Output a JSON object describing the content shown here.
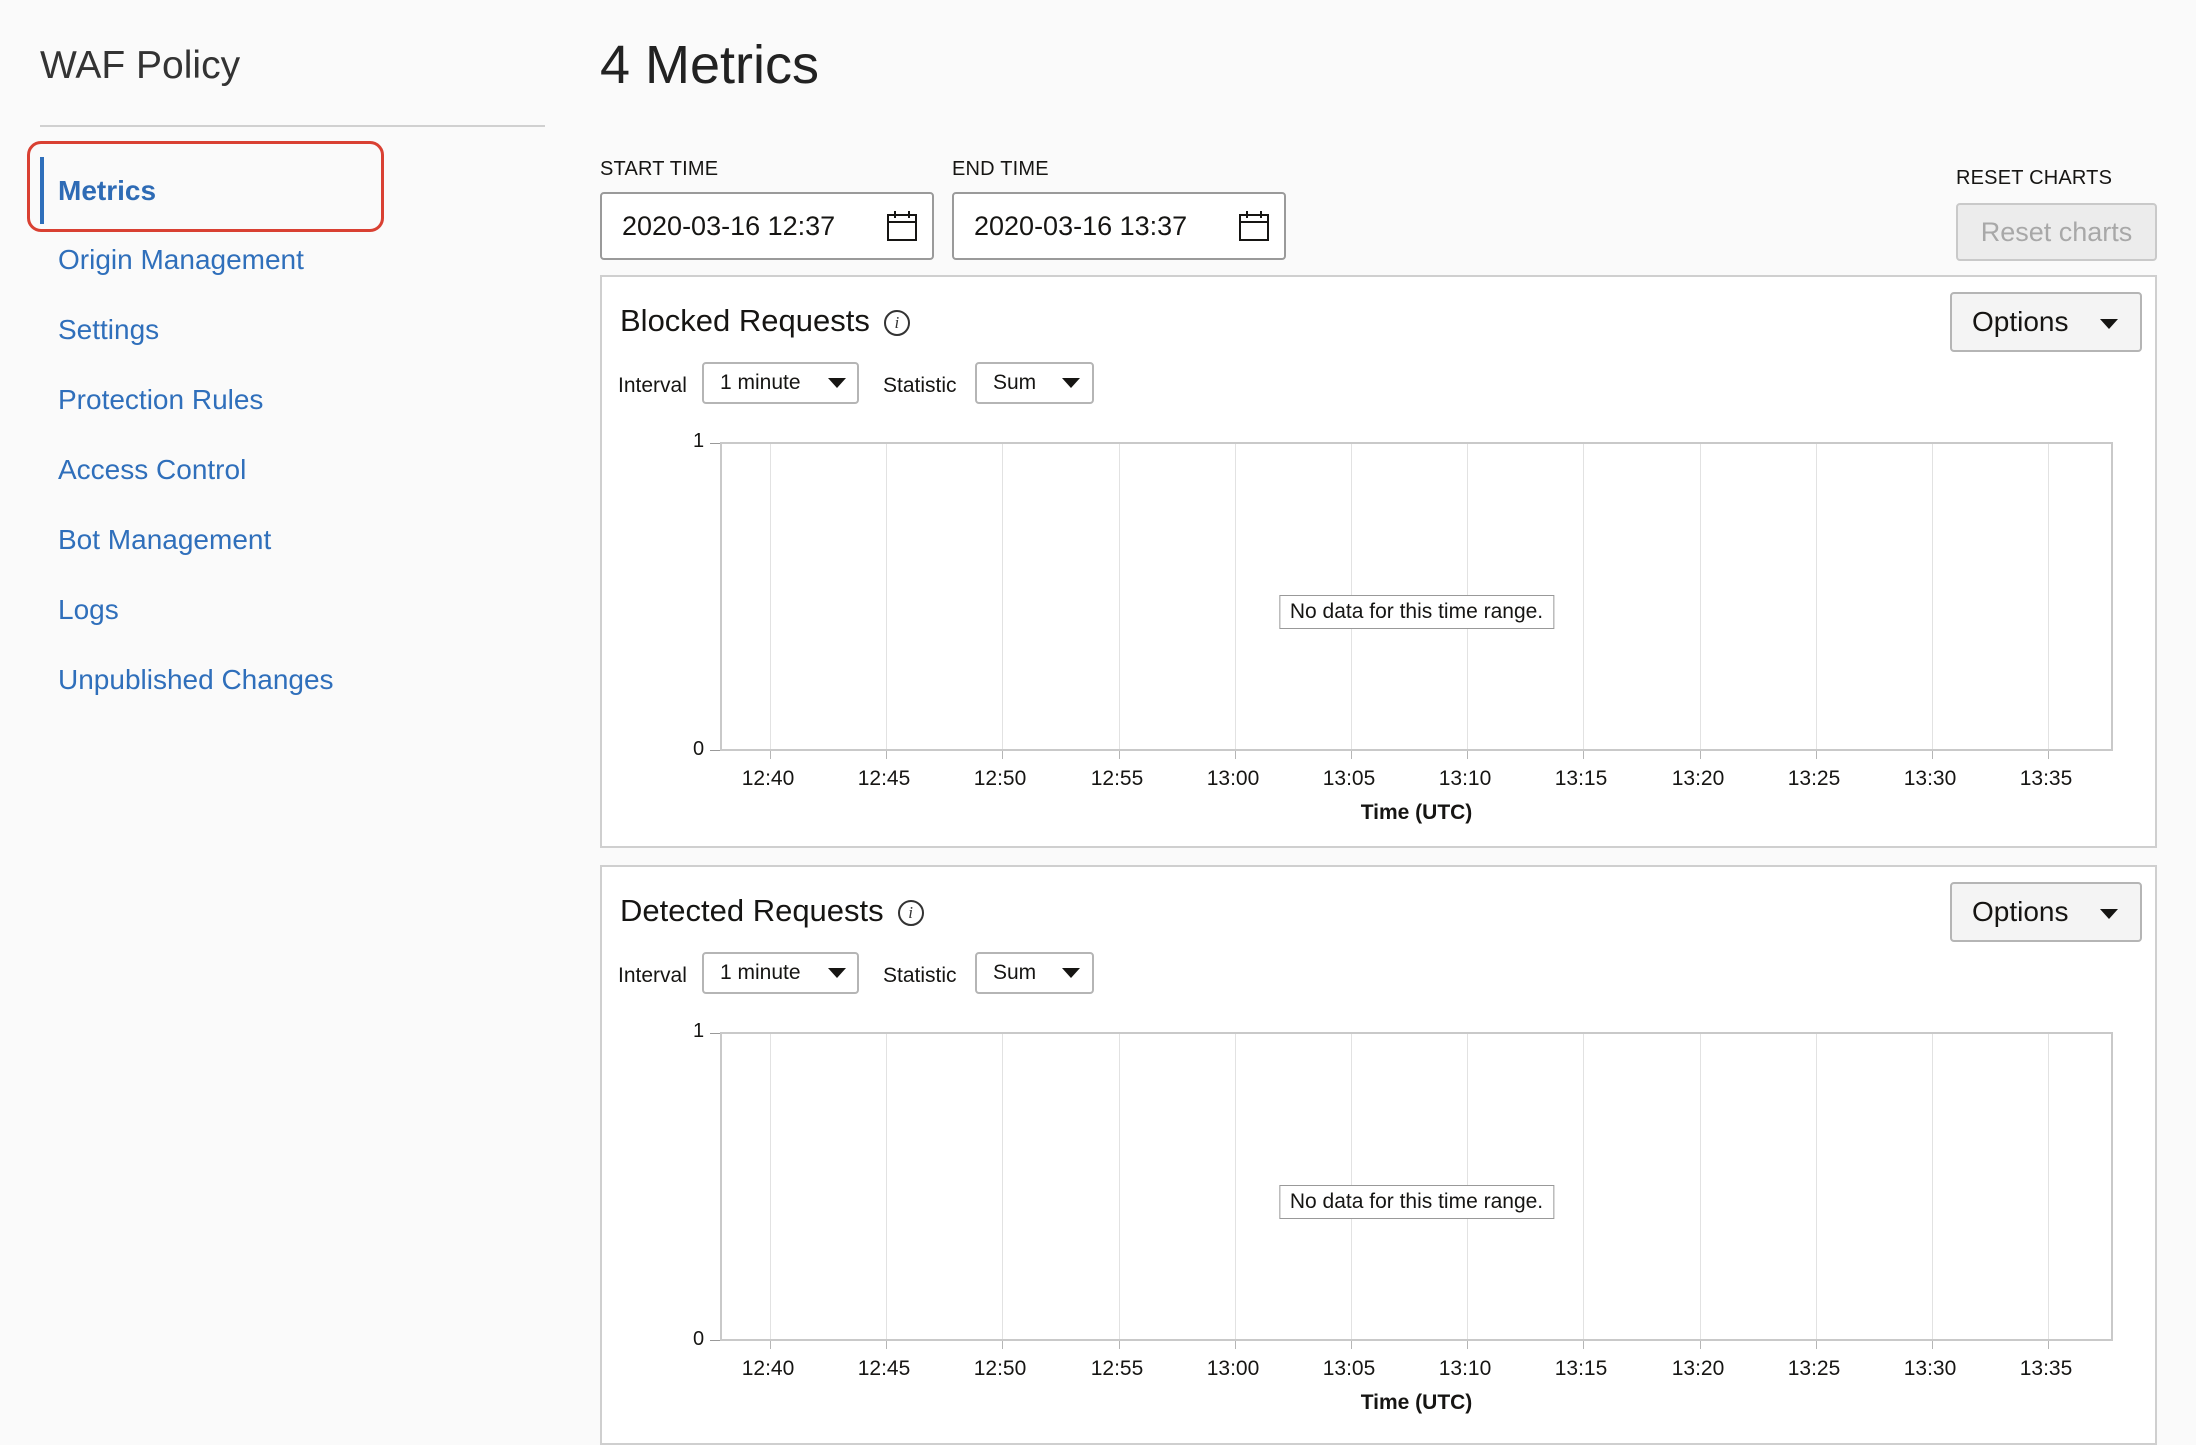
{
  "sidebar": {
    "title": "WAF Policy",
    "items": [
      {
        "label": "Metrics",
        "active": true
      },
      {
        "label": "Origin Management"
      },
      {
        "label": "Settings"
      },
      {
        "label": "Protection Rules"
      },
      {
        "label": "Access Control"
      },
      {
        "label": "Bot Management"
      },
      {
        "label": "Logs"
      },
      {
        "label": "Unpublished Changes"
      }
    ]
  },
  "header": {
    "title": "4 Metrics"
  },
  "filters": {
    "start_label": "START TIME",
    "start_value": "2020-03-16 12:37",
    "end_label": "END TIME",
    "end_value": "2020-03-16 13:37",
    "reset_label": "RESET CHARTS",
    "reset_button": "Reset charts"
  },
  "colors": {
    "accent": "#2f6fbb",
    "highlight": "#d94032"
  },
  "icons": {
    "calendar": "calendar-icon",
    "info": "info-icon",
    "caret": "chevron-down-icon"
  },
  "charts": [
    {
      "title": "Blocked Requests",
      "options_label": "Options",
      "interval_label": "Interval",
      "interval_value": "1 minute",
      "statistic_label": "Statistic",
      "statistic_value": "Sum",
      "no_data": "No data for this time range."
    },
    {
      "title": "Detected Requests",
      "options_label": "Options",
      "interval_label": "Interval",
      "interval_value": "1 minute",
      "statistic_label": "Statistic",
      "statistic_value": "Sum",
      "no_data": "No data for this time range."
    }
  ],
  "chart_data": [
    {
      "type": "line",
      "categories": [
        "12:40",
        "12:45",
        "12:50",
        "12:55",
        "13:00",
        "13:05",
        "13:10",
        "13:15",
        "13:20",
        "13:25",
        "13:30",
        "13:35"
      ],
      "series": [],
      "xlabel": "Time (UTC)",
      "ylabel": "",
      "ylim": [
        0,
        1
      ],
      "yticks": [
        "1",
        "0"
      ],
      "grid": true
    },
    {
      "type": "line",
      "categories": [
        "12:40",
        "12:45",
        "12:50",
        "12:55",
        "13:00",
        "13:05",
        "13:10",
        "13:15",
        "13:20",
        "13:25",
        "13:30",
        "13:35"
      ],
      "series": [],
      "xlabel": "Time (UTC)",
      "ylabel": "",
      "ylim": [
        0,
        1
      ],
      "yticks": [
        "1",
        "0"
      ],
      "grid": true
    }
  ]
}
